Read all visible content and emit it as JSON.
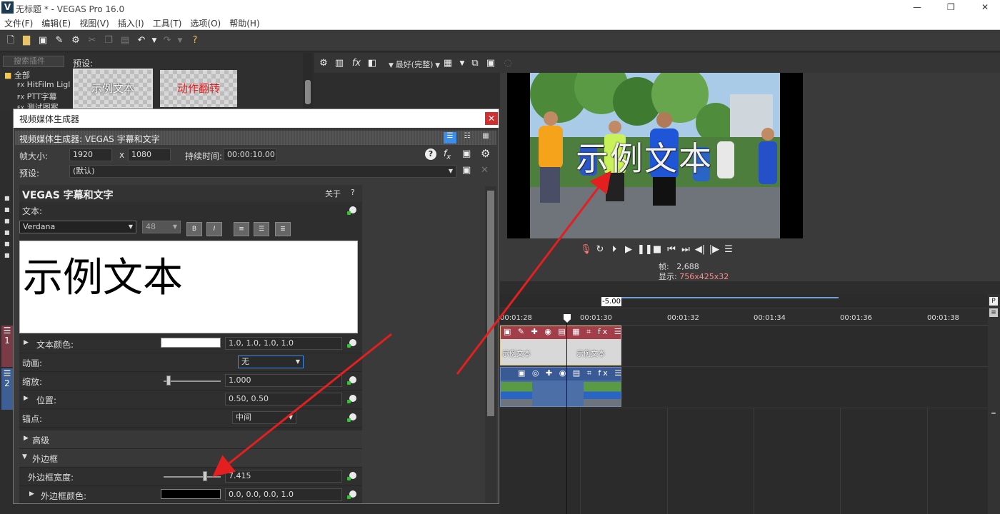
{
  "window": {
    "title": "无标题 * - VEGAS Pro 16.0",
    "logo": "V",
    "controls": [
      "—",
      "❐",
      "✕"
    ]
  },
  "menu": [
    "文件(F)",
    "编辑(E)",
    "视图(V)",
    "插入(I)",
    "工具(T)",
    "选项(O)",
    "帮助(H)"
  ],
  "explorer": {
    "search_placeholder": "搜索插件",
    "tree": [
      "全部",
      "HitFilm Ligl",
      "PTT字幕",
      "测试图案"
    ],
    "presets_label": "预设:",
    "presets": [
      {
        "label": "示例文本",
        "color": "#ffffff"
      },
      {
        "label": "动作翻转",
        "color": "#e02020"
      }
    ]
  },
  "preview_toolbar": {
    "quality": "最好(完整)"
  },
  "preview": {
    "overlay_text": "示例文本",
    "frame_label": "帧:",
    "frame_value": "2,688",
    "display_label": "显示:",
    "display_value": "756x425x32"
  },
  "timeline": {
    "speed": "-5.00",
    "ticks": [
      "00:01:28",
      "00:01:30",
      "00:01:32",
      "00:01:34",
      "00:01:36",
      "00:01:38"
    ],
    "text_clip_label": "示例文本",
    "left_tiles": [
      "1",
      "2"
    ],
    "right_buttons": [
      "P",
      "≡"
    ]
  },
  "dialog": {
    "title": "视频媒体生成器",
    "header": "视频媒体生成器: VEGAS 字幕和文字",
    "frame_size_label": "帧大小:",
    "width": "1920",
    "x": "x",
    "height": "1080",
    "duration_label": "持续时间:",
    "duration": "00:00:10.00",
    "preset_label": "预设:",
    "preset_value": "(默认)",
    "plugin_name": "VEGAS 字幕和文字",
    "about": "关于",
    "help": "?",
    "text_label": "文本:",
    "font": "Verdana",
    "font_size": "48",
    "text_content": "示例文本",
    "rows": {
      "text_color_label": "文本颜色:",
      "text_color_value": "1.0, 1.0, 1.0, 1.0",
      "animation_label": "动画:",
      "animation_value": "无",
      "scale_label": "缩放:",
      "scale_value": "1.000",
      "position_label": "位置:",
      "position_value": "0.50, 0.50",
      "anchor_label": "锚点:",
      "anchor_value": "中间",
      "advanced_label": "高级",
      "outline_section": "外边框",
      "outline_width_label": "外边框宽度:",
      "outline_width_value": "7.415",
      "outline_color_label": "外边框颜色:",
      "outline_color_value": "0.0, 0.0, 0.0, 1.0"
    },
    "outline_width_fraction": 0.74
  },
  "colors": {
    "accent_red": "#e31f1f",
    "selection_blue": "#3d8ee8",
    "clip_blue": "#4d6fa8"
  }
}
